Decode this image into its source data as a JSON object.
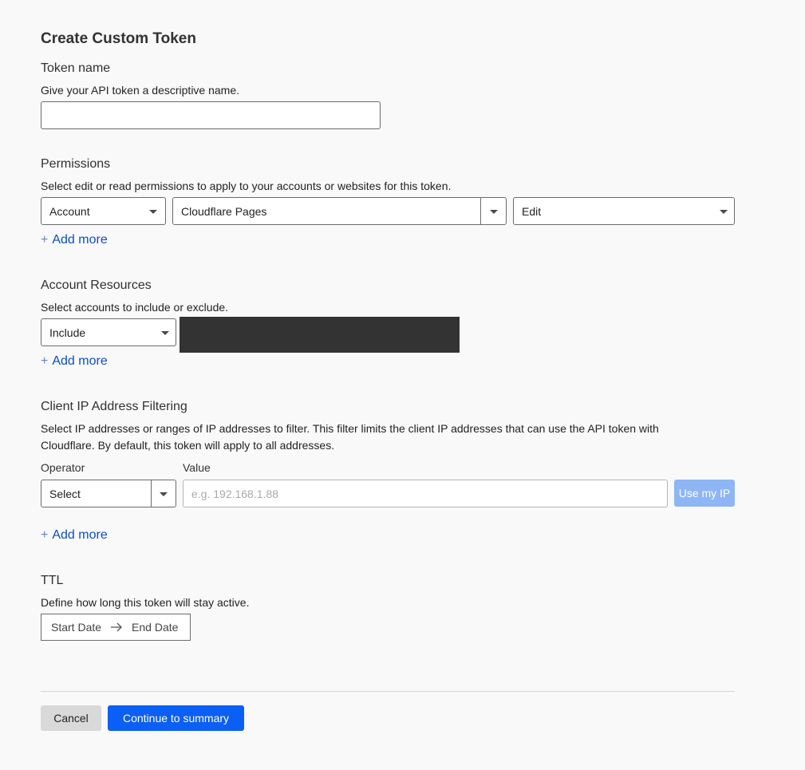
{
  "page": {
    "title": "Create Custom Token"
  },
  "token_name": {
    "heading": "Token name",
    "description": "Give your API token a descriptive name.",
    "value": ""
  },
  "permissions": {
    "heading": "Permissions",
    "description": "Select edit or read permissions to apply to your accounts or websites for this token.",
    "scope": "Account",
    "resource": "Cloudflare Pages",
    "access": "Edit",
    "add_more": "Add more"
  },
  "account_resources": {
    "heading": "Account Resources",
    "description": "Select accounts to include or exclude.",
    "mode": "Include",
    "add_more": "Add more",
    "redaction_color": "#333333"
  },
  "ip_filtering": {
    "heading": "Client IP Address Filtering",
    "description": "Select IP addresses or ranges of IP addresses to filter. This filter limits the client IP addresses that can use the API token with Cloudflare. By default, this token will apply to all addresses.",
    "operator_label": "Operator",
    "value_label": "Value",
    "operator_value": "Select",
    "value_placeholder": "e.g. 192.168.1.88",
    "use_my_ip": "Use my IP",
    "add_more": "Add more"
  },
  "ttl": {
    "heading": "TTL",
    "description": "Define how long this token will stay active.",
    "start_date": "Start Date",
    "end_date": "End Date"
  },
  "footer": {
    "cancel": "Cancel",
    "continue": "Continue to summary"
  },
  "colors": {
    "primary": "#0b5ff4",
    "link": "#0a4fc0",
    "disabled_button": "#8eb6f5"
  }
}
